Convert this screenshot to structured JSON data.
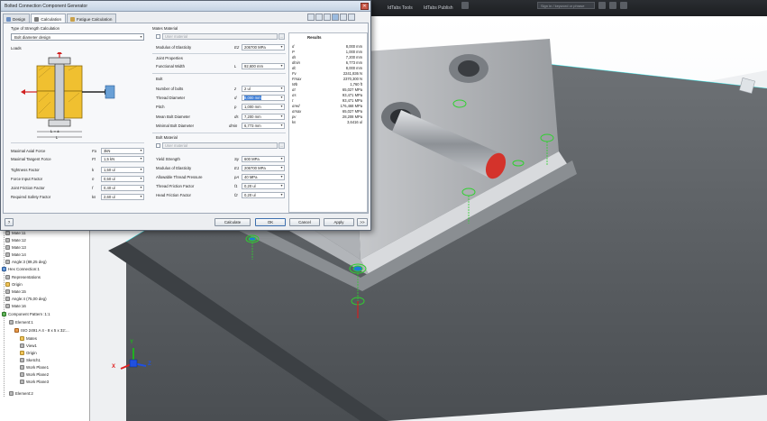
{
  "app": {
    "ribbon_items": [
      "IdTabs Tools",
      "IdTabs Publish"
    ],
    "search_placeholder": "Sign in / keyword or phrase"
  },
  "dialog": {
    "title": "Bolted Connection Component Generator",
    "close_icon": "close-icon",
    "tabs": [
      {
        "label": "Design",
        "icon": "design-icon"
      },
      {
        "label": "Calculation",
        "icon": "calculator-icon"
      },
      {
        "label": "Fatigue Calculation",
        "icon": "fatigue-icon"
      }
    ],
    "strength_calc": {
      "title": "Type of Strength Calculation",
      "selected": "Bolt diameter design"
    },
    "loads": {
      "title": "Loads",
      "rows": [
        {
          "label": "Maximal Axial Force",
          "sym": "Fa",
          "value": "3kN"
        },
        {
          "label": "Maximal Tangent Force",
          "sym": "Ft",
          "value": "1,5 kN"
        },
        {
          "label": "Tightness Factor",
          "sym": "k",
          "value": "1,50 ul"
        },
        {
          "label": "Force Input Factor",
          "sym": "n",
          "value": "0,50 ul"
        },
        {
          "label": "Joint Friction Factor",
          "sym": "f",
          "value": "0,40 ul"
        },
        {
          "label": "Required Safety Factor",
          "sym": "ks",
          "value": "2,60 ul"
        }
      ]
    },
    "mates_material": {
      "title": "Mates Material",
      "user_material": "User material",
      "modulus": {
        "label": "Modulus of Elasticity",
        "sym": "E2",
        "value": "206700 MPa"
      },
      "joint_title": "Joint Properties",
      "functional_width": {
        "label": "Functional Width",
        "sym": "L",
        "value": "92,600 mm"
      }
    },
    "bolt": {
      "title": "Bolt",
      "rows": [
        {
          "label": "Number of bolts",
          "sym": "z",
          "value": "2 ul"
        },
        {
          "label": "Thread Diameter",
          "sym": "d",
          "value": "8,000 mm"
        },
        {
          "label": "Pitch",
          "sym": "p",
          "value": "1,000 mm"
        },
        {
          "label": "Mean Bolt Diameter",
          "sym": "ds",
          "value": "7,200 mm"
        },
        {
          "label": "Minimal Bolt Diameter",
          "sym": "dmin",
          "value": "6,773 mm"
        }
      ]
    },
    "bolt_material": {
      "title": "Bolt Material",
      "user_material": "User material",
      "rows": [
        {
          "label": "Yield Strength",
          "sym": "Sy",
          "value": "600 MPa"
        },
        {
          "label": "Modulus of Elasticity",
          "sym": "E1",
          "value": "206700 MPa"
        },
        {
          "label": "Allowable Thread Pressure",
          "sym": "pA",
          "value": "40 MPa"
        },
        {
          "label": "Thread Friction Factor",
          "sym": "f1",
          "value": "0,20 ul"
        },
        {
          "label": "Head Friction Factor",
          "sym": "f2",
          "value": "0,20 ul"
        }
      ]
    },
    "results": {
      "title": "Results",
      "rows": [
        {
          "name": "d",
          "value": "8,000 mm"
        },
        {
          "name": "P",
          "value": "1,000 mm"
        },
        {
          "name": "ds",
          "value": "7,200 mm"
        },
        {
          "name": "dmin",
          "value": "6,773 mm"
        },
        {
          "name": "dc",
          "value": "8,000 mm"
        },
        {
          "name": "Fv",
          "value": "2241,836 N"
        },
        {
          "name": "Fmax",
          "value": "2370,300 N"
        },
        {
          "name": "Wb",
          "value": "1,760 ft"
        },
        {
          "name": "σt",
          "value": "65,027 MPa"
        },
        {
          "name": "σs",
          "value": "93,471 MPa"
        },
        {
          "name": "τ",
          "value": "93,471 MPa"
        },
        {
          "name": "σred",
          "value": "176,468 MPa"
        },
        {
          "name": "σmax",
          "value": "65,027 MPa"
        },
        {
          "name": "pv",
          "value": "28,208 MPa"
        },
        {
          "name": "ks",
          "value": "3,6416 ul"
        }
      ]
    },
    "buttons": {
      "calculate": "Calculate",
      "ok": "OK",
      "cancel": "Cancel",
      "apply": "Apply",
      "more": ">>"
    },
    "diagram": {
      "label_L": "L",
      "label_LeE": "L = ±"
    }
  },
  "browser": {
    "items": [
      {
        "label": "Mate:11",
        "icon": "gray"
      },
      {
        "label": "Mate:12",
        "icon": "gray"
      },
      {
        "label": "Mate:13",
        "icon": "gray"
      },
      {
        "label": "Mate:14",
        "icon": "gray"
      },
      {
        "label": "Angle:3 (89,25 deg)",
        "icon": "gray"
      },
      {
        "label": "Hex Connection:1",
        "icon": "blue"
      },
      {
        "label": "Representations",
        "icon": "gray"
      },
      {
        "label": "Origin",
        "icon": "folder"
      },
      {
        "label": "Mate:15",
        "icon": "gray"
      },
      {
        "label": "Angle:4 (75,00 deg)",
        "icon": "gray"
      },
      {
        "label": "Mate:16",
        "icon": "gray"
      },
      {
        "label": "Component Pattern :1:1",
        "icon": "green"
      },
      {
        "label": "Element:1",
        "icon": "gray"
      },
      {
        "label": "ISO 2491 A 4 - 8 x 5 x 32:...",
        "icon": "orange"
      },
      {
        "label": "Mates",
        "icon": "folder"
      },
      {
        "label": "View1",
        "icon": "gray"
      },
      {
        "label": "Origin",
        "icon": "folder"
      },
      {
        "label": "Sketch1",
        "icon": "gray"
      },
      {
        "label": "Work Plane1",
        "icon": "gray"
      },
      {
        "label": "Work Plane2",
        "icon": "gray"
      },
      {
        "label": "Work Plane3",
        "icon": "gray"
      },
      {
        "label": "Element:2",
        "icon": "gray"
      }
    ]
  },
  "triad": {
    "x": "X",
    "y": "Y",
    "z": "Z"
  },
  "colors": {
    "accent": "#3a7bd5",
    "bolt_green": "#2fd12f",
    "axis_x": "#e02020",
    "axis_y": "#20b020",
    "axis_z": "#2050e0"
  }
}
